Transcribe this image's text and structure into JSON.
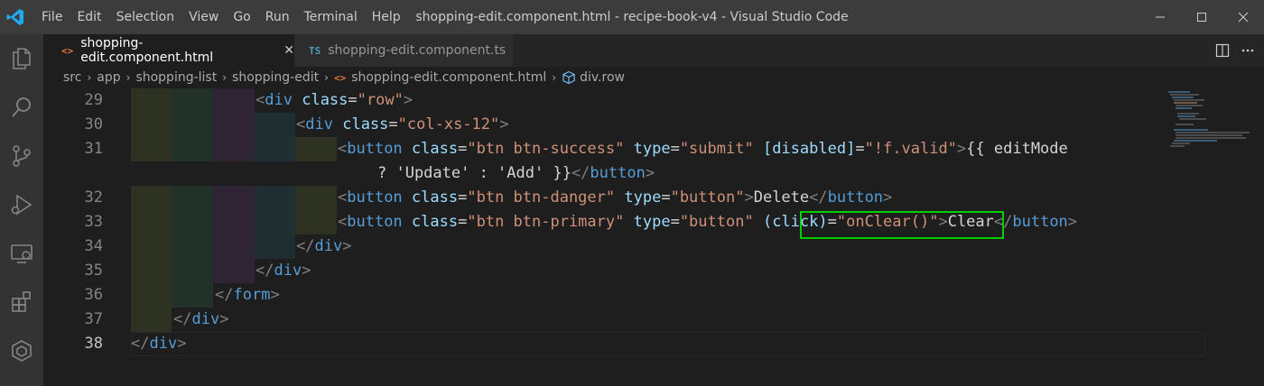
{
  "window": {
    "title": "shopping-edit.component.html - recipe-book-v4 - Visual Studio Code",
    "menu": [
      "File",
      "Edit",
      "Selection",
      "View",
      "Go",
      "Run",
      "Terminal",
      "Help"
    ],
    "controls": [
      "minimize-icon",
      "maximize-icon",
      "close-icon"
    ]
  },
  "activity_bar": [
    "explorer-icon",
    "search-icon",
    "source-control-icon",
    "run-debug-icon",
    "remote-explorer-icon",
    "extensions-icon",
    "angular-icon"
  ],
  "tabs": [
    {
      "label": "shopping-edit.component.html",
      "icon_text": "<>",
      "icon_color": "#e37933",
      "active": true,
      "close": "✕"
    },
    {
      "label": "shopping-edit.component.ts",
      "icon_text": "TS",
      "icon_color": "#519aba",
      "active": false
    }
  ],
  "breadcrumbs": [
    "src",
    "app",
    "shopping-list",
    "shopping-edit",
    "shopping-edit.component.html",
    "div.row"
  ],
  "editor": {
    "line_numbers": [
      "29",
      "30",
      "31",
      "",
      "32",
      "33",
      "34",
      "35",
      "36",
      "37",
      "38"
    ],
    "current_line": "38",
    "lines": [
      [
        [
          "br",
          "<"
        ],
        [
          "tag",
          "div"
        ],
        [
          "txt",
          " "
        ],
        [
          "attr",
          "class"
        ],
        [
          "txt",
          "="
        ],
        [
          "str",
          "\"row\""
        ],
        [
          "br",
          ">"
        ]
      ],
      [
        [
          "br",
          "<"
        ],
        [
          "tag",
          "div"
        ],
        [
          "txt",
          " "
        ],
        [
          "attr",
          "class"
        ],
        [
          "txt",
          "="
        ],
        [
          "str",
          "\"col-xs-12\""
        ],
        [
          "br",
          ">"
        ]
      ],
      [
        [
          "br",
          "<"
        ],
        [
          "tag",
          "button"
        ],
        [
          "txt",
          " "
        ],
        [
          "attr",
          "class"
        ],
        [
          "txt",
          "="
        ],
        [
          "str",
          "\"btn btn-success\""
        ],
        [
          "txt",
          " "
        ],
        [
          "attr",
          "type"
        ],
        [
          "txt",
          "="
        ],
        [
          "str",
          "\"submit\""
        ],
        [
          "txt",
          " "
        ],
        [
          "attr",
          "[disabled]"
        ],
        [
          "txt",
          "="
        ],
        [
          "str",
          "\"!f.valid\""
        ],
        [
          "br",
          ">"
        ],
        [
          "txt",
          "{{ editMode"
        ]
      ],
      [
        [
          "txt",
          "? 'Update' : 'Add' }}"
        ],
        [
          "br",
          "</"
        ],
        [
          "tag",
          "button"
        ],
        [
          "br",
          ">"
        ]
      ],
      [
        [
          "br",
          "<"
        ],
        [
          "tag",
          "button"
        ],
        [
          "txt",
          " "
        ],
        [
          "attr",
          "class"
        ],
        [
          "txt",
          "="
        ],
        [
          "str",
          "\"btn btn-danger\""
        ],
        [
          "txt",
          " "
        ],
        [
          "attr",
          "type"
        ],
        [
          "txt",
          "="
        ],
        [
          "str",
          "\"button\""
        ],
        [
          "br",
          ">"
        ],
        [
          "txt",
          "Delete"
        ],
        [
          "br",
          "</"
        ],
        [
          "tag",
          "button"
        ],
        [
          "br",
          ">"
        ]
      ],
      [
        [
          "br",
          "<"
        ],
        [
          "tag",
          "button"
        ],
        [
          "txt",
          " "
        ],
        [
          "attr",
          "class"
        ],
        [
          "txt",
          "="
        ],
        [
          "str",
          "\"btn btn-primary\""
        ],
        [
          "txt",
          " "
        ],
        [
          "attr",
          "type"
        ],
        [
          "txt",
          "="
        ],
        [
          "str",
          "\"button\""
        ],
        [
          "txt",
          " "
        ],
        [
          "attr",
          "(click)"
        ],
        [
          "txt",
          "="
        ],
        [
          "str",
          "\"onClear()\""
        ],
        [
          "br",
          ">"
        ],
        [
          "txt",
          "Clear"
        ],
        [
          "br",
          "</"
        ],
        [
          "tag",
          "button"
        ],
        [
          "br",
          ">"
        ]
      ],
      [
        [
          "br",
          "</"
        ],
        [
          "tag",
          "div"
        ],
        [
          "br",
          ">"
        ]
      ],
      [
        [
          "br",
          "</"
        ],
        [
          "tag",
          "div"
        ],
        [
          "br",
          ">"
        ]
      ],
      [
        [
          "br",
          "</"
        ],
        [
          "tag",
          "form"
        ],
        [
          "br",
          ">"
        ]
      ],
      [
        [
          "br",
          "</"
        ],
        [
          "tag",
          "div"
        ],
        [
          "br",
          ">"
        ]
      ],
      [
        [
          "br",
          "</"
        ],
        [
          "tag",
          "div"
        ],
        [
          "br",
          ">"
        ]
      ]
    ]
  }
}
